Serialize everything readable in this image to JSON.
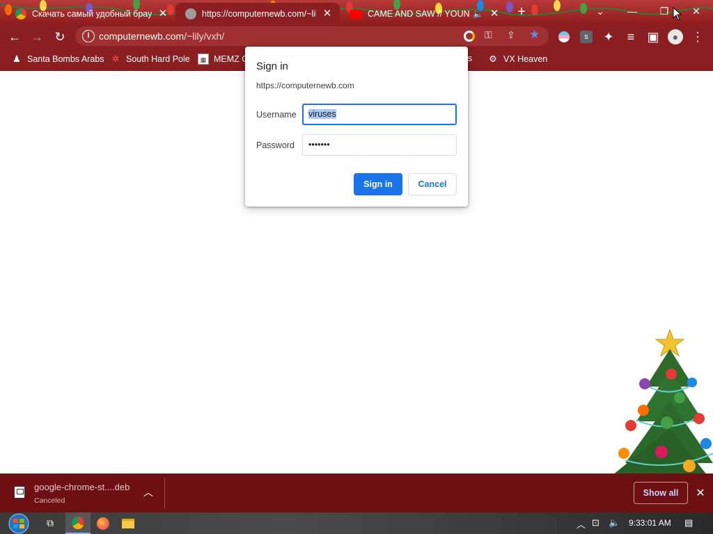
{
  "tabs": [
    {
      "title": "Скачать самый удобный брауз",
      "favicon": "chrome-icon",
      "active": false
    },
    {
      "title": "https://computernewb.com/~lily",
      "favicon": "globe-icon",
      "active": true
    },
    {
      "title": "CAME AND SAW // YOUNG",
      "favicon": "youtube-icon",
      "active": false
    }
  ],
  "address": {
    "host": "computernewb.com",
    "path": "/~lily/vxh/"
  },
  "bookmarks": [
    {
      "label": "Santa Bombs Arabs",
      "icon": "bomb-icon"
    },
    {
      "label": "South Hard Pole",
      "icon": "snowflake-icon"
    },
    {
      "label": "MEMZ C",
      "icon": "memz-icon"
    },
    {
      "label": "Os",
      "icon": "folder-icon"
    },
    {
      "label": "VX Heaven",
      "icon": "vx-icon"
    }
  ],
  "dialog": {
    "title": "Sign in",
    "origin": "https://computernewb.com",
    "username_label": "Username",
    "username_value": "viruses",
    "password_label": "Password",
    "password_value": "•••••••",
    "signin_label": "Sign in",
    "cancel_label": "Cancel"
  },
  "download": {
    "filename": "google-chrome-st....deb",
    "status": "Canceled",
    "show_all_label": "Show all"
  },
  "taskbar": {
    "clock": "9:33:01 AM"
  },
  "colors": {
    "chrome_frame": "#8a1e20",
    "accent": "#1a73e8",
    "shelf": "#6d0f13"
  }
}
